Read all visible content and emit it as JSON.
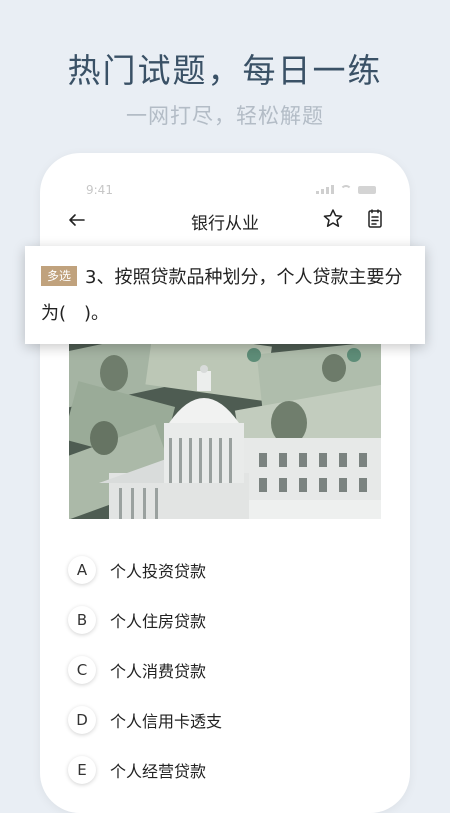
{
  "promo": {
    "headline": "热门试题，每日一练",
    "subline": "一网打尽，轻松解题"
  },
  "status": {
    "time": "9:41"
  },
  "nav": {
    "title": "银行从业"
  },
  "question": {
    "badge": "多选",
    "text": "3、按照贷款品种划分，个人贷款主要分为(　)。"
  },
  "options": [
    {
      "letter": "A",
      "text": "个人投资贷款"
    },
    {
      "letter": "B",
      "text": "个人住房贷款"
    },
    {
      "letter": "C",
      "text": "个人消费贷款"
    },
    {
      "letter": "D",
      "text": "个人信用卡透支"
    },
    {
      "letter": "E",
      "text": "个人经营贷款"
    }
  ],
  "colors": {
    "background": "#e9eef4",
    "headline": "#3a5166",
    "badge": "#c0a27d"
  },
  "icons": [
    "back-arrow-icon",
    "star-icon",
    "notes-icon"
  ]
}
